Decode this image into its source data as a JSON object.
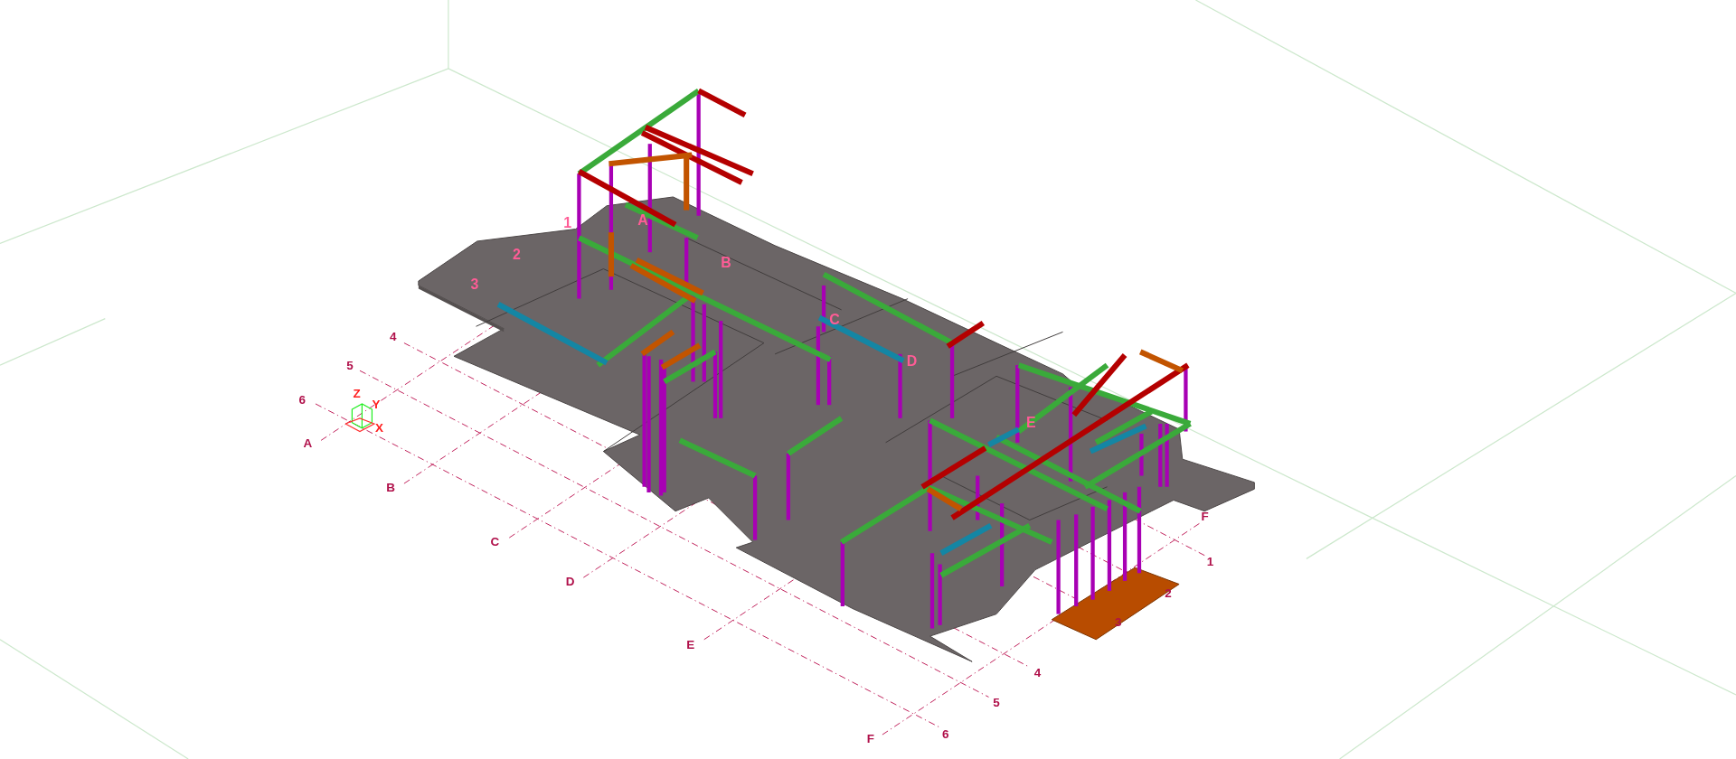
{
  "model_labels": [
    {
      "text": "1"
    },
    {
      "text": "2"
    },
    {
      "text": "3"
    },
    {
      "text": "A"
    },
    {
      "text": "B"
    },
    {
      "text": "C"
    },
    {
      "text": "D"
    },
    {
      "text": "E"
    }
  ],
  "grid_labels_left": [
    {
      "text": "4"
    },
    {
      "text": "5"
    },
    {
      "text": "6"
    },
    {
      "text": "A"
    },
    {
      "text": "B"
    },
    {
      "text": "C"
    },
    {
      "text": "D"
    },
    {
      "text": "E"
    },
    {
      "text": "F"
    }
  ],
  "grid_labels_right": [
    {
      "text": "F"
    },
    {
      "text": "1"
    },
    {
      "text": "2"
    },
    {
      "text": "3"
    },
    {
      "text": "4"
    },
    {
      "text": "5"
    },
    {
      "text": "6"
    }
  ],
  "axes": [
    {
      "text": "Z"
    },
    {
      "text": "Y"
    },
    {
      "text": "X"
    }
  ]
}
